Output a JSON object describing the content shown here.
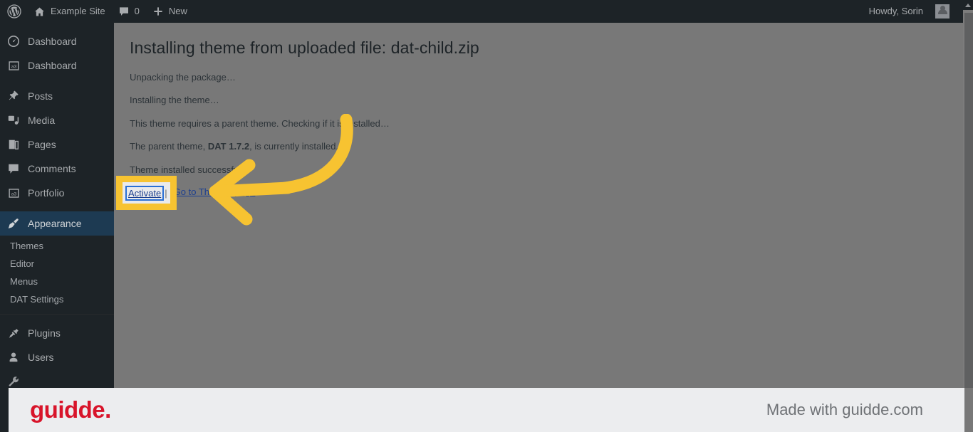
{
  "adminbar": {
    "logo_icon": "wordpress-logo-icon",
    "site_name": "Example Site",
    "site_icon": "home-icon",
    "comments_icon": "comment-bubble-icon",
    "comments_count": "0",
    "new_icon": "plus-icon",
    "new_label": "New",
    "howdy": "Howdy, Sorin",
    "avatar_icon": "user-avatar-icon"
  },
  "sidebar": {
    "items": [
      {
        "label": "Dashboard",
        "icon": "dashboard-gauge-icon",
        "active": false
      },
      {
        "label": "Dashboard",
        "icon": "a3-block-icon",
        "active": false
      },
      {
        "label": "Posts",
        "icon": "pin-icon",
        "active": false
      },
      {
        "label": "Media",
        "icon": "media-icon",
        "active": false
      },
      {
        "label": "Pages",
        "icon": "pages-icon",
        "active": false
      },
      {
        "label": "Comments",
        "icon": "comment-bubble-icon",
        "active": false
      },
      {
        "label": "Portfolio",
        "icon": "a3-block-icon",
        "active": false
      },
      {
        "label": "Appearance",
        "icon": "paintbrush-icon",
        "active": true
      },
      {
        "label": "Plugins",
        "icon": "plug-icon",
        "active": false
      },
      {
        "label": "Users",
        "icon": "user-icon",
        "active": false
      }
    ],
    "submenu": [
      {
        "label": "Themes"
      },
      {
        "label": "Editor"
      },
      {
        "label": "Menus"
      },
      {
        "label": "DAT Settings"
      }
    ]
  },
  "main": {
    "title": "Installing theme from uploaded file: dat-child.zip",
    "log": [
      {
        "text": "Unpacking the package…"
      },
      {
        "text": "Installing the theme…"
      },
      {
        "text": "This theme requires a parent theme. Checking if it is installed…"
      },
      {
        "text_before": "The parent theme, ",
        "bold": "DAT 1.7.2",
        "text_after": ", is currently installed."
      },
      {
        "text": "Theme installed successfully."
      }
    ],
    "actions": {
      "activate_label": "Activate",
      "separator": "|",
      "themes_label": "Go to Themes page"
    }
  },
  "highlight": {
    "color": "#F7C331",
    "target_label": "Activate",
    "separator": "|",
    "secondary_label": "Go to The"
  },
  "scrollbar": {
    "up_arrow_icon": "scroll-up-arrow-icon"
  },
  "footer": {
    "logo_text": "guidde.",
    "logo_color": "#D8142A",
    "made_with": "Made with guidde.com"
  }
}
